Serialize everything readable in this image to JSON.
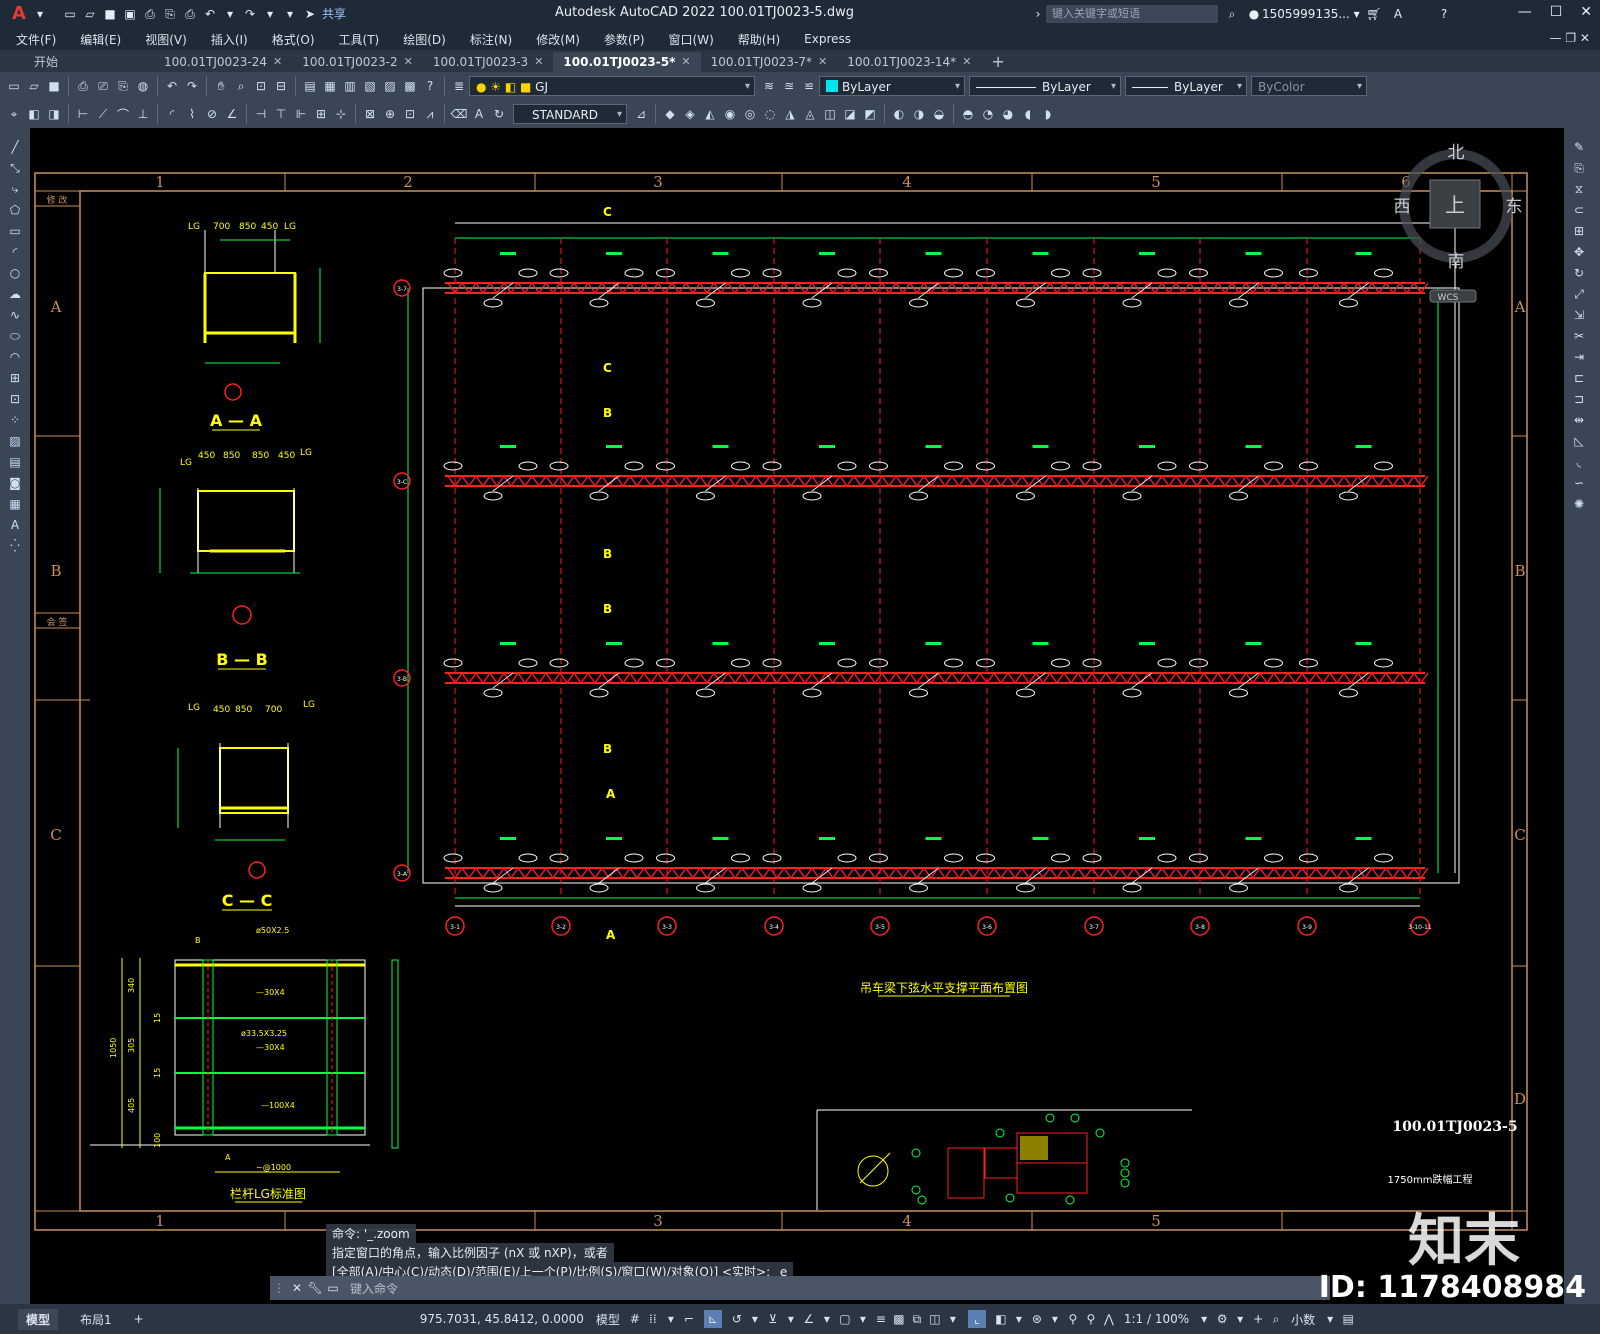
{
  "app": {
    "title": "Autodesk AutoCAD 2022    100.01TJ0023-5.dwg",
    "share_label": "共享",
    "search_placeholder": "键入关键字或短语",
    "user": "1505999135...",
    "logo": "A"
  },
  "menu": [
    "文件(F)",
    "编辑(E)",
    "视图(V)",
    "插入(I)",
    "格式(O)",
    "工具(T)",
    "绘图(D)",
    "标注(N)",
    "修改(M)",
    "参数(P)",
    "窗口(W)",
    "帮助(H)",
    "Express"
  ],
  "tabs": [
    {
      "label": "开始",
      "active": false
    },
    {
      "label": "100.01TJ0023-24",
      "active": false
    },
    {
      "label": "100.01TJ0023-2",
      "active": false
    },
    {
      "label": "100.01TJ0023-3",
      "active": false
    },
    {
      "label": "100.01TJ0023-5*",
      "active": true
    },
    {
      "label": "100.01TJ0023-7*",
      "active": false
    },
    {
      "label": "100.01TJ0023-14*",
      "active": false
    }
  ],
  "toolbar": {
    "layer": "GJ",
    "color": "ByLayer",
    "linetype": "ByLayer",
    "lineweight": "ByLayer",
    "plotstyle": "ByColor",
    "textstyle": "STANDARD"
  },
  "viewcube": {
    "north": "北",
    "south": "南",
    "east": "东",
    "west": "西",
    "top": "上",
    "wcs": "WCS"
  },
  "drawing": {
    "grid_top": [
      "1",
      "2",
      "3",
      "4",
      "5",
      "6"
    ],
    "grid_bottom": [
      "1",
      "2",
      "3",
      "4",
      "5"
    ],
    "grid_side": [
      "A",
      "B",
      "C",
      "D"
    ],
    "title_block_left_top": "修  改",
    "title_block_left_mid": "会  签",
    "section_a": "A — A",
    "section_b": "B — B",
    "section_c": "C — C",
    "section_lg": "栏杆LG标准图",
    "plan_title": "吊车梁下弦水平支撑平面布置图",
    "drawing_no": "100.01TJ0023-5",
    "project_line": "1750mm跌幅工程",
    "dim_a": [
      "700",
      "850",
      "450"
    ],
    "dim_b": [
      "450",
      "850",
      "850",
      "450"
    ],
    "dim_c": [
      "450",
      "850",
      "700"
    ],
    "lg_label": "LG",
    "lg_dims": [
      "340",
      "305",
      "405",
      "1050",
      "100",
      "15",
      "15"
    ],
    "lg_notes": [
      "ø50X2.5",
      "—30X4",
      "ø33.5X3.25",
      "—30X4",
      "—100X4",
      "~@1000",
      "A",
      "B"
    ],
    "axis_rows": [
      "3-7",
      "3-C",
      "3-B",
      "3-A"
    ],
    "axis_cols": [
      "3-1",
      "3-2",
      "3-3",
      "3-4",
      "3-5",
      "3-6",
      "3-7",
      "3-8",
      "3-9",
      "3-10-11"
    ],
    "cmark_c": "C",
    "cmark_b": "B",
    "cmark_a": "A"
  },
  "command": {
    "line1": "命令: '_.zoom",
    "line2": "指定窗口的角点，输入比例因子 (nX 或 nXP)，或者",
    "line3": "[全部(A)/中心(C)/动态(D)/范围(E)/上一个(P)/比例(S)/窗口(W)/对象(O)] <实时>: _e",
    "placeholder": "键入命令"
  },
  "status": {
    "layout_tabs": [
      "模型",
      "布局1"
    ],
    "coords": "975.7031, 45.8412, 0.0000",
    "mode": "模型",
    "scale": "1:1 / 100%",
    "units": "小数"
  },
  "watermark": {
    "brand": "知末",
    "id": "ID: 1178408984"
  },
  "colors": {
    "accent": "#5b7fb3",
    "truss": "#ff2020",
    "dim": "#00ff44",
    "yellow": "#ffff00",
    "frame": "#c8915a"
  }
}
